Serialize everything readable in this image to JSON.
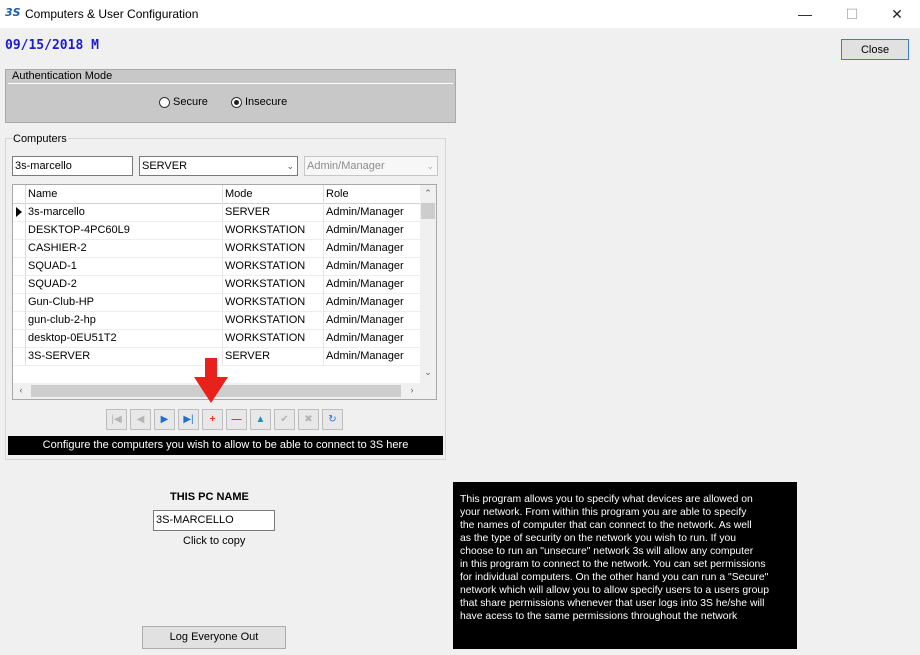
{
  "window": {
    "app_icon_text": "3S",
    "title": "Computers & User Configuration",
    "minimize": "—",
    "maximize": "☐",
    "close": "✕"
  },
  "header": {
    "date": "09/15/2018 M",
    "close_label": "Close"
  },
  "auth": {
    "legend": "Authentication Mode",
    "options": [
      "Secure",
      "Insecure"
    ],
    "selected": "Insecure"
  },
  "computers": {
    "legend": "Computers",
    "name_value": "3s-marcello",
    "mode_value": "SERVER",
    "role_value": "Admin/Manager",
    "columns": [
      "Name",
      "Mode",
      "Role"
    ],
    "rows": [
      {
        "name": "3s-marcello",
        "mode": "SERVER",
        "role": "Admin/Manager"
      },
      {
        "name": "DESKTOP-4PC60L9",
        "mode": "WORKSTATION",
        "role": "Admin/Manager"
      },
      {
        "name": "CASHIER-2",
        "mode": "WORKSTATION",
        "role": "Admin/Manager"
      },
      {
        "name": "SQUAD-1",
        "mode": "WORKSTATION",
        "role": "Admin/Manager"
      },
      {
        "name": "SQUAD-2",
        "mode": "WORKSTATION",
        "role": "Admin/Manager"
      },
      {
        "name": "Gun-Club-HP",
        "mode": "WORKSTATION",
        "role": "Admin/Manager"
      },
      {
        "name": "gun-club-2-hp",
        "mode": "WORKSTATION",
        "role": "Admin/Manager"
      },
      {
        "name": "desktop-0EU51T2",
        "mode": "WORKSTATION",
        "role": "Admin/Manager"
      },
      {
        "name": "3S-SERVER",
        "mode": "SERVER",
        "role": "Admin/Manager"
      }
    ],
    "nav_icons": [
      "first-record-icon",
      "prior-record-icon",
      "next-record-icon",
      "last-record-icon",
      "add-record-icon",
      "delete-record-icon",
      "edit-record-icon",
      "post-record-icon",
      "cancel-record-icon",
      "refresh-icon"
    ],
    "hint": "Configure the computers you wish to allow to be able to connect to 3S here"
  },
  "pc": {
    "title": "THIS PC NAME",
    "value": "3S-MARCELLO",
    "copy_label": "Click to copy"
  },
  "logout_label": "Log Everyone Out",
  "info_lines": [
    "This program allows you to specify what devices are allowed  on",
    "your network. From within this program you are able to specify",
    "the names of computer that can connect to the network. As well",
    "as the type of security on the network you wish to run. If you",
    "choose to run an \"unsecure\" network 3s will allow any computer",
    "in this program to connect to the network. You can set permissions",
    "for individual computers. On the other hand you can run a \"Secure\"",
    "network which will allow you to allow specify users to a users group",
    "that share permissions whenever that user logs into 3S he/she will",
    " have acess to the same permissions throughout the network"
  ],
  "colors": {
    "date_color": "#1b1bd0",
    "auth_bg": "#c8c8c8",
    "annotation_arrow": "#e8211b",
    "info_bg": "#000000"
  }
}
